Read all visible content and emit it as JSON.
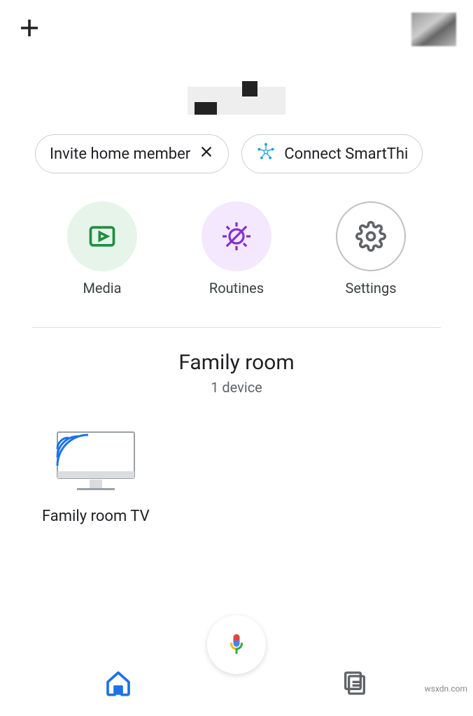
{
  "chips": {
    "invite_label": "Invite home member",
    "connect_label": "Connect SmartThi"
  },
  "shortcuts": {
    "media": "Media",
    "routines": "Routines",
    "settings": "Settings"
  },
  "room": {
    "name": "Family room",
    "device_count": "1 device"
  },
  "devices": {
    "tv_label": "Family room TV"
  },
  "watermark": "wsxdn.com"
}
